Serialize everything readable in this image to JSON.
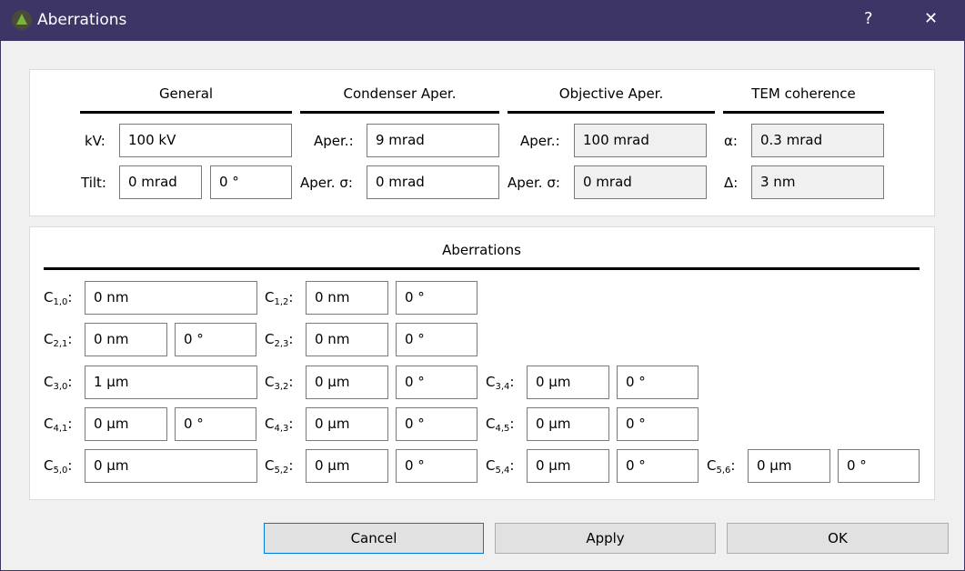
{
  "window": {
    "title": "Aberrations",
    "help": "?",
    "close": "✕"
  },
  "general": {
    "header": "General",
    "kv_label": "kV:",
    "kv": "100 kV",
    "tilt_label": "Tilt:",
    "tilt": "0 mrad",
    "tilt_angle": "0 °"
  },
  "condenser": {
    "header": "Condenser Aper.",
    "aper_label": "Aper.:",
    "aper": "9 mrad",
    "sigma_label": "Aper. σ:",
    "sigma": "0 mrad"
  },
  "objective": {
    "header": "Objective Aper.",
    "aper_label": "Aper.:",
    "aper": "100 mrad",
    "sigma_label": "Aper. σ:",
    "sigma": "0 mrad"
  },
  "coherence": {
    "header": "TEM coherence",
    "alpha_label": "α:",
    "alpha": "0.3 mrad",
    "delta_label": "Δ:",
    "delta": "3 nm"
  },
  "aberrations": {
    "header": "Aberrations",
    "rows": [
      [
        {
          "n": "1",
          "m": "0",
          "value": "0 nm"
        },
        {
          "n": "1",
          "m": "2",
          "value": "0 nm",
          "angle": "0 °"
        }
      ],
      [
        {
          "n": "2",
          "m": "1",
          "value": "0 nm",
          "angle": "0 °"
        },
        {
          "n": "2",
          "m": "3",
          "value": "0 nm",
          "angle": "0 °"
        }
      ],
      [
        {
          "n": "3",
          "m": "0",
          "value": "1 µm"
        },
        {
          "n": "3",
          "m": "2",
          "value": "0 µm",
          "angle": "0 °"
        },
        {
          "n": "3",
          "m": "4",
          "value": "0 µm",
          "angle": "0 °"
        }
      ],
      [
        {
          "n": "4",
          "m": "1",
          "value": "0 µm",
          "angle": "0 °"
        },
        {
          "n": "4",
          "m": "3",
          "value": "0 µm",
          "angle": "0 °"
        },
        {
          "n": "4",
          "m": "5",
          "value": "0 µm",
          "angle": "0 °"
        }
      ],
      [
        {
          "n": "5",
          "m": "0",
          "value": "0 µm"
        },
        {
          "n": "5",
          "m": "2",
          "value": "0 µm",
          "angle": "0 °"
        },
        {
          "n": "5",
          "m": "4",
          "value": "0 µm",
          "angle": "0 °"
        },
        {
          "n": "5",
          "m": "6",
          "value": "0 µm",
          "angle": "0 °"
        }
      ]
    ]
  },
  "buttons": {
    "cancel": "Cancel",
    "apply": "Apply",
    "ok": "OK"
  }
}
